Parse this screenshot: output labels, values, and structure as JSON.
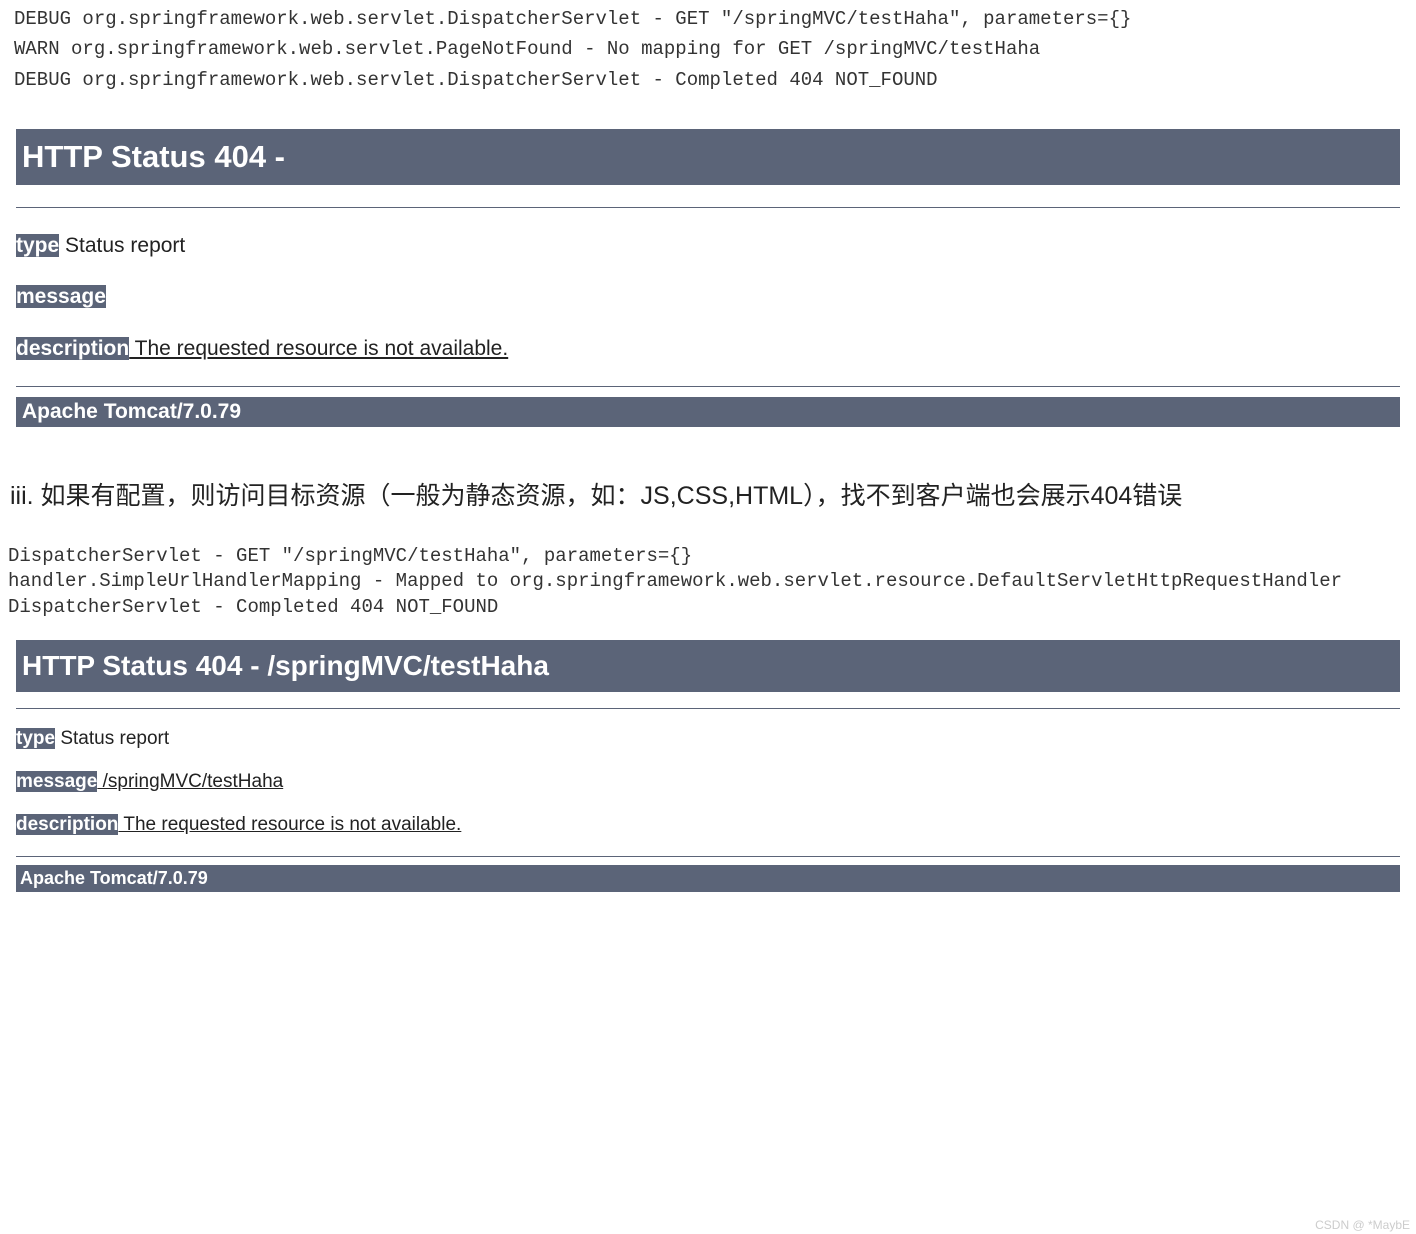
{
  "log1": {
    "line1": "DEBUG org.springframework.web.servlet.DispatcherServlet - GET \"/springMVC/testHaha\", parameters={}",
    "line2": "WARN org.springframework.web.servlet.PageNotFound - No mapping for GET /springMVC/testHaha",
    "line3": "DEBUG org.springframework.web.servlet.DispatcherServlet - Completed 404 NOT_FOUND"
  },
  "error1": {
    "title": "HTTP Status 404 -",
    "type_label": "type",
    "type_value": " Status report",
    "message_label": "message",
    "message_value": "",
    "desc_label": "description",
    "desc_value": " The requested resource is not available.",
    "footer": "Apache Tomcat/7.0.79"
  },
  "body_text": "iii. 如果有配置，则访问目标资源（一般为静态资源，如：JS,CSS,HTML），找不到客户端也会展示404错误",
  "log2": {
    "line1": "DispatcherServlet - GET \"/springMVC/testHaha\", parameters={}",
    "line2": "handler.SimpleUrlHandlerMapping - Mapped to org.springframework.web.servlet.resource.DefaultServletHttpRequestHandler",
    "line3": "DispatcherServlet - Completed 404 NOT_FOUND"
  },
  "error2": {
    "title": "HTTP Status 404 - /springMVC/testHaha",
    "type_label": "type",
    "type_value": " Status report",
    "message_label": "message",
    "message_value": " /springMVC/testHaha",
    "desc_label": "description",
    "desc_value": " The requested resource is not available.",
    "footer": "Apache Tomcat/7.0.79"
  },
  "watermark": "CSDN @ *MaybE"
}
